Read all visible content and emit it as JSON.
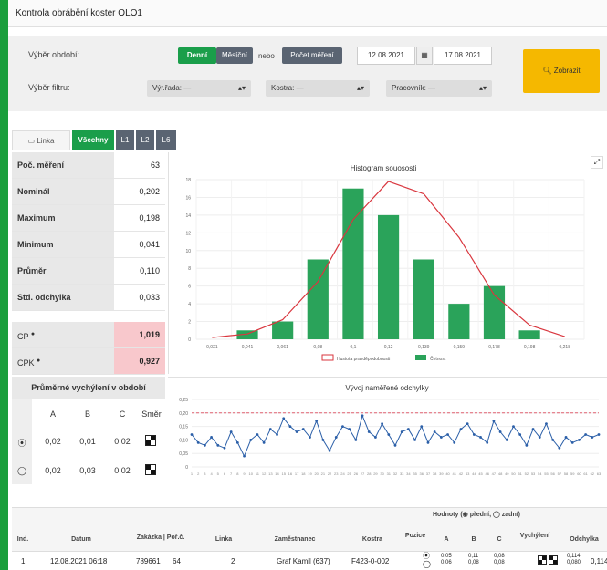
{
  "window": {
    "title": "Kontrola obrábění koster OLO1"
  },
  "filters": {
    "period_label": "Výběr období:",
    "daily": "Denní",
    "monthly": "Měsíční",
    "or": "nebo",
    "count": "Počet měření",
    "date_from": "12.08.2021",
    "date_to": "17.08.2021",
    "filter_label": "Výběr filtru:",
    "series_label": "Výr.řada:",
    "series_value": "—",
    "frame_label": "Kostra:",
    "frame_value": "—",
    "worker_label": "Pracovník:",
    "worker_value": "—",
    "show_button": "Zobrazit"
  },
  "tabs": [
    "Linka",
    "Všechny",
    "L1",
    "L2",
    "L6"
  ],
  "stats": [
    {
      "label": "Poč. měření",
      "value": "63"
    },
    {
      "label": "Nominál",
      "value": "0,202"
    },
    {
      "label": "Maximum",
      "value": "0,198"
    },
    {
      "label": "Minimum",
      "value": "0,041"
    },
    {
      "label": "Průměr",
      "value": "0,110"
    },
    {
      "label": "Std. odchylka",
      "value": "0,033"
    }
  ],
  "cp": {
    "label": "CP",
    "value": "1,019"
  },
  "cpk": {
    "label": "CPK",
    "value": "0,927"
  },
  "avg_deviation": {
    "title": "Průměrné vychýlení v období",
    "headers": [
      "A",
      "B",
      "C",
      "Směr"
    ],
    "rows": [
      {
        "values": [
          "0,02",
          "0,01",
          "0,02"
        ]
      },
      {
        "values": [
          "0,02",
          "0,03",
          "0,02"
        ]
      }
    ]
  },
  "histogram_title": "Histogram souososti",
  "trend_title": "Vývoj naměřené odchylky",
  "chart_data": [
    {
      "type": "bar",
      "title": "Histogram souososti",
      "categories": [
        "0,021",
        "0,041",
        "0,061",
        "0,08",
        "0,1",
        "0,12",
        "0,139",
        "0,159",
        "0,178",
        "0,198",
        "0,218"
      ],
      "values": [
        0,
        1,
        2,
        9,
        17,
        14,
        9,
        4,
        6,
        1,
        0
      ],
      "ylim": [
        0,
        18
      ],
      "yticks": [
        0,
        2,
        4,
        6,
        8,
        10,
        12,
        14,
        16,
        18
      ],
      "series": [
        {
          "name": "Četnost",
          "color": "#2aa35a"
        },
        {
          "name": "Hustota pravděpodobnosti",
          "color": "#d9363e"
        }
      ],
      "density_curve": [
        0.2,
        0.6,
        2.2,
        6.5,
        13.5,
        17.8,
        16.4,
        11.5,
        5.0,
        1.6,
        0.3
      ]
    },
    {
      "type": "line",
      "title": "Vývoj naměřené odchylky",
      "ylim": [
        0,
        0.25
      ],
      "yticks": [
        "0",
        "0,05",
        "0,10",
        "0,15",
        "0,20",
        "0,25"
      ],
      "limit": 0.2,
      "values": [
        0.12,
        0.09,
        0.08,
        0.11,
        0.08,
        0.07,
        0.13,
        0.09,
        0.04,
        0.1,
        0.12,
        0.09,
        0.14,
        0.12,
        0.18,
        0.15,
        0.13,
        0.14,
        0.11,
        0.17,
        0.1,
        0.06,
        0.11,
        0.15,
        0.14,
        0.1,
        0.19,
        0.13,
        0.11,
        0.16,
        0.12,
        0.08,
        0.13,
        0.14,
        0.1,
        0.15,
        0.09,
        0.13,
        0.11,
        0.12,
        0.09,
        0.14,
        0.16,
        0.12,
        0.11,
        0.09,
        0.17,
        0.13,
        0.1,
        0.15,
        0.12,
        0.08,
        0.14,
        0.11,
        0.16,
        0.1,
        0.07,
        0.11,
        0.09,
        0.1,
        0.12,
        0.11,
        0.12
      ]
    }
  ],
  "table": {
    "group_header": "Hodnoty (◉ přední, ◯ zadní)",
    "headers": [
      "Ind.",
      "Datum",
      "Zakázka | Poř.č.",
      "Linka",
      "Zaměstnanec",
      "Kostra",
      "Pozice",
      "A",
      "B",
      "C",
      "Vychýlení",
      "Odchylka"
    ],
    "row": {
      "ind": "1",
      "date": "12.08.2021 06:18",
      "order": "789661",
      "seq": "64",
      "line": "2",
      "employee": "Graf Kamil (637)",
      "frame": "F423-0-002",
      "a": "0,05 0,06",
      "b": "0,11 0,08",
      "c": "0,08 0,08",
      "deviation": "0,114 0,080",
      "deviation_main": "0,114"
    }
  }
}
